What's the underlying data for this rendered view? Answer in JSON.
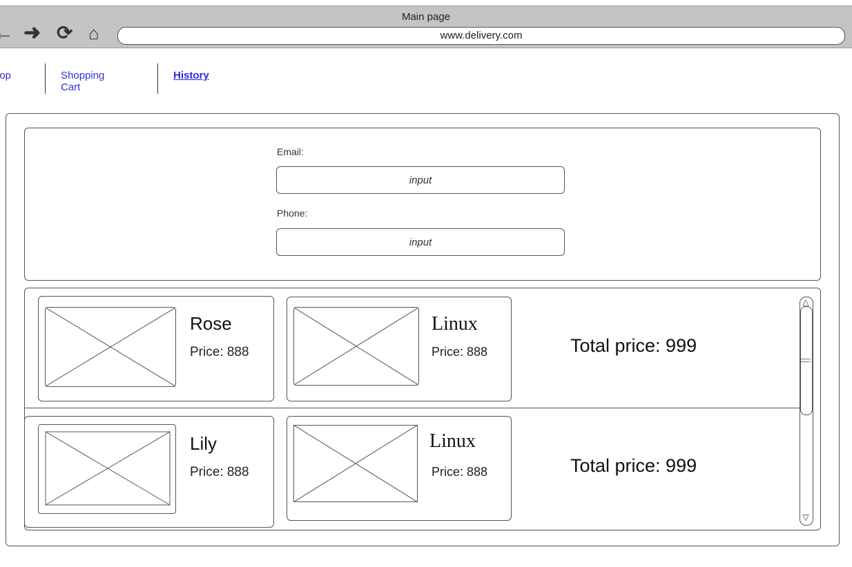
{
  "browser": {
    "title": "Main page",
    "url": "www.delivery.com",
    "icons": [
      "back-arrow-icon",
      "forward-arrow-icon",
      "reload-icon",
      "home-icon"
    ]
  },
  "tabs": [
    {
      "label": "hop"
    },
    {
      "label": "Shopping Cart"
    },
    {
      "label": "History"
    }
  ],
  "contact": {
    "email_label": "Email:",
    "email_placeholder": "input",
    "phone_label": "Phone:",
    "phone_placeholder": "input"
  },
  "orders": [
    {
      "items": [
        {
          "name": "Rose",
          "price": "Price: 888"
        },
        {
          "name": "Linux",
          "price": "Price: 888"
        }
      ],
      "total": "Total price: 999"
    },
    {
      "items": [
        {
          "name": "Lily",
          "price": "Price: 888"
        },
        {
          "name": "Linux",
          "price": "Price: 888"
        }
      ],
      "total": "Total price: 999"
    }
  ],
  "colors": {
    "chrome_bg": "#c4c4c4",
    "link": "#3333cc",
    "border": "#555555"
  }
}
